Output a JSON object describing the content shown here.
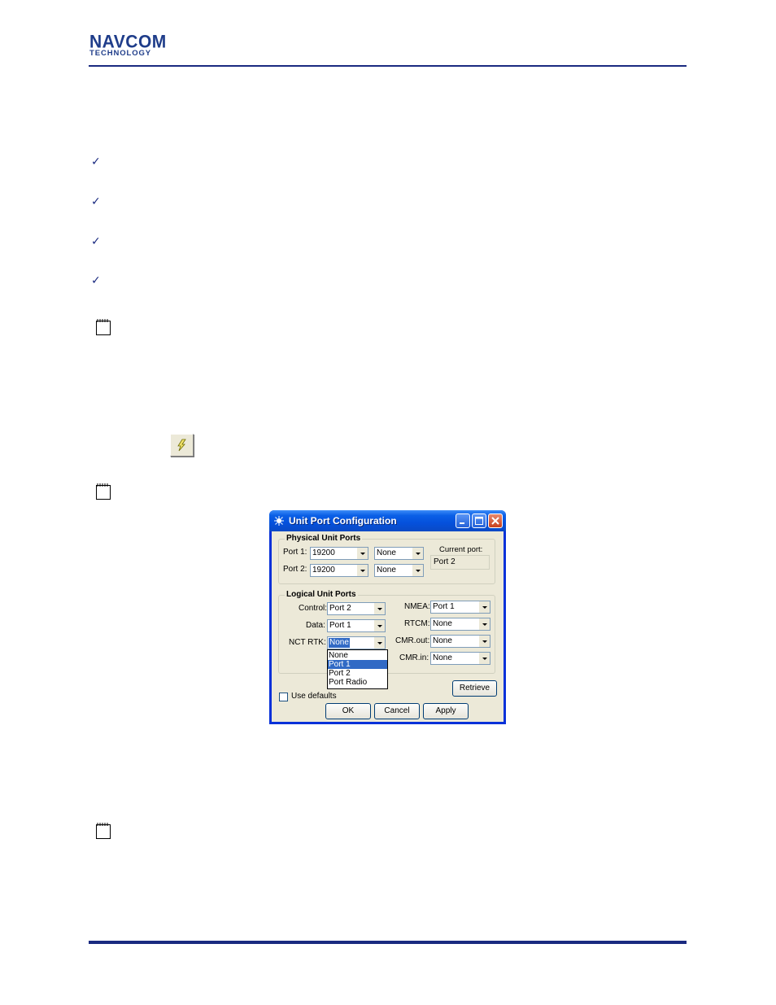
{
  "header": {
    "logo_main": "NAVCOM",
    "logo_sub": "TECHNOLOGY"
  },
  "bullets": {
    "check_glyph": "✓"
  },
  "icons": [
    "notepad-icon",
    "toolbar-port-icon"
  ],
  "dialog": {
    "title": "Unit Port Configuration",
    "physical": {
      "group_label": "Physical  Unit Ports",
      "port1_label": "Port 1:",
      "port1_baud": "19200",
      "port1_mode": "None",
      "port2_label": "Port 2:",
      "port2_baud": "19200",
      "port2_mode": "None",
      "current_port_label": "Current port:",
      "current_port_value": "Port 2"
    },
    "logical": {
      "group_label": "Logical Unit Ports",
      "control_label": "Control:",
      "control_value": "Port 2",
      "data_label": "Data:",
      "data_value": "Port 1",
      "nct_rtk_label": "NCT RTK:",
      "nct_rtk_value": "None",
      "nmea_label": "NMEA:",
      "nmea_value": "Port 1",
      "rtcm_label": "RTCM:",
      "rtcm_value": "None",
      "cmr_out_label": "CMR.out:",
      "cmr_out_value": "None",
      "cmr_in_label": "CMR.in:",
      "cmr_in_value": "None",
      "dropdown_options": [
        "None",
        "Port 1",
        "Port 2",
        "Port Radio"
      ],
      "dropdown_highlighted": "Port 1"
    },
    "use_defaults_label": "Use defaults",
    "retrieve_label": "Retrieve",
    "ok_label": "OK",
    "cancel_label": "Cancel",
    "apply_label": "Apply"
  },
  "colors": {
    "brand_navy": "#1a2a80",
    "xp_title_blue": "#0a5fe6",
    "selection_blue": "#316ac5"
  }
}
